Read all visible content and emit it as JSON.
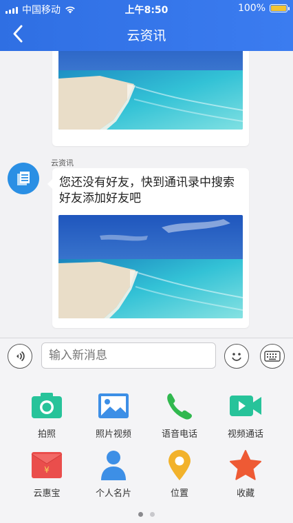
{
  "status_bar": {
    "carrier": "中国移动",
    "time": "上午8:50",
    "battery": "100%",
    "battery_level": 1.0,
    "battery_color": "#f3c432"
  },
  "nav": {
    "back_icon": "chevron-left-icon",
    "title": "云资讯",
    "background": "#3478ea"
  },
  "chat": {
    "messages": [
      {
        "type": "image",
        "image": "beach-photo"
      },
      {
        "sender": "云资讯",
        "avatar_icon": "document-icon",
        "text": "您还没有好友，快到通讯录中搜索好友添加好友吧",
        "image": "beach-photo"
      }
    ]
  },
  "input_bar": {
    "voice_icon": "voice-icon",
    "placeholder": "输入新消息",
    "emoji_icon": "emoji-icon",
    "keyboard_icon": "keyboard-icon"
  },
  "panel": {
    "items": [
      {
        "label": "拍照",
        "icon": "camera-icon",
        "color": "#27c39a"
      },
      {
        "label": "照片视频",
        "icon": "photo-icon",
        "color": "#3d8fe6"
      },
      {
        "label": "语音电话",
        "icon": "phone-icon",
        "color": "#31b84f"
      },
      {
        "label": "视频通话",
        "icon": "video-call-icon",
        "color": "#27c39a"
      },
      {
        "label": "云惠宝",
        "icon": "red-packet-icon",
        "color": "#ea4e4c"
      },
      {
        "label": "个人名片",
        "icon": "contact-card-icon",
        "color": "#3d8fe6"
      },
      {
        "label": "位置",
        "icon": "location-pin-icon",
        "color": "#f2b22b"
      },
      {
        "label": "收藏",
        "icon": "star-icon",
        "color": "#ee5a34"
      }
    ],
    "pages": 2,
    "active_page": 1
  }
}
